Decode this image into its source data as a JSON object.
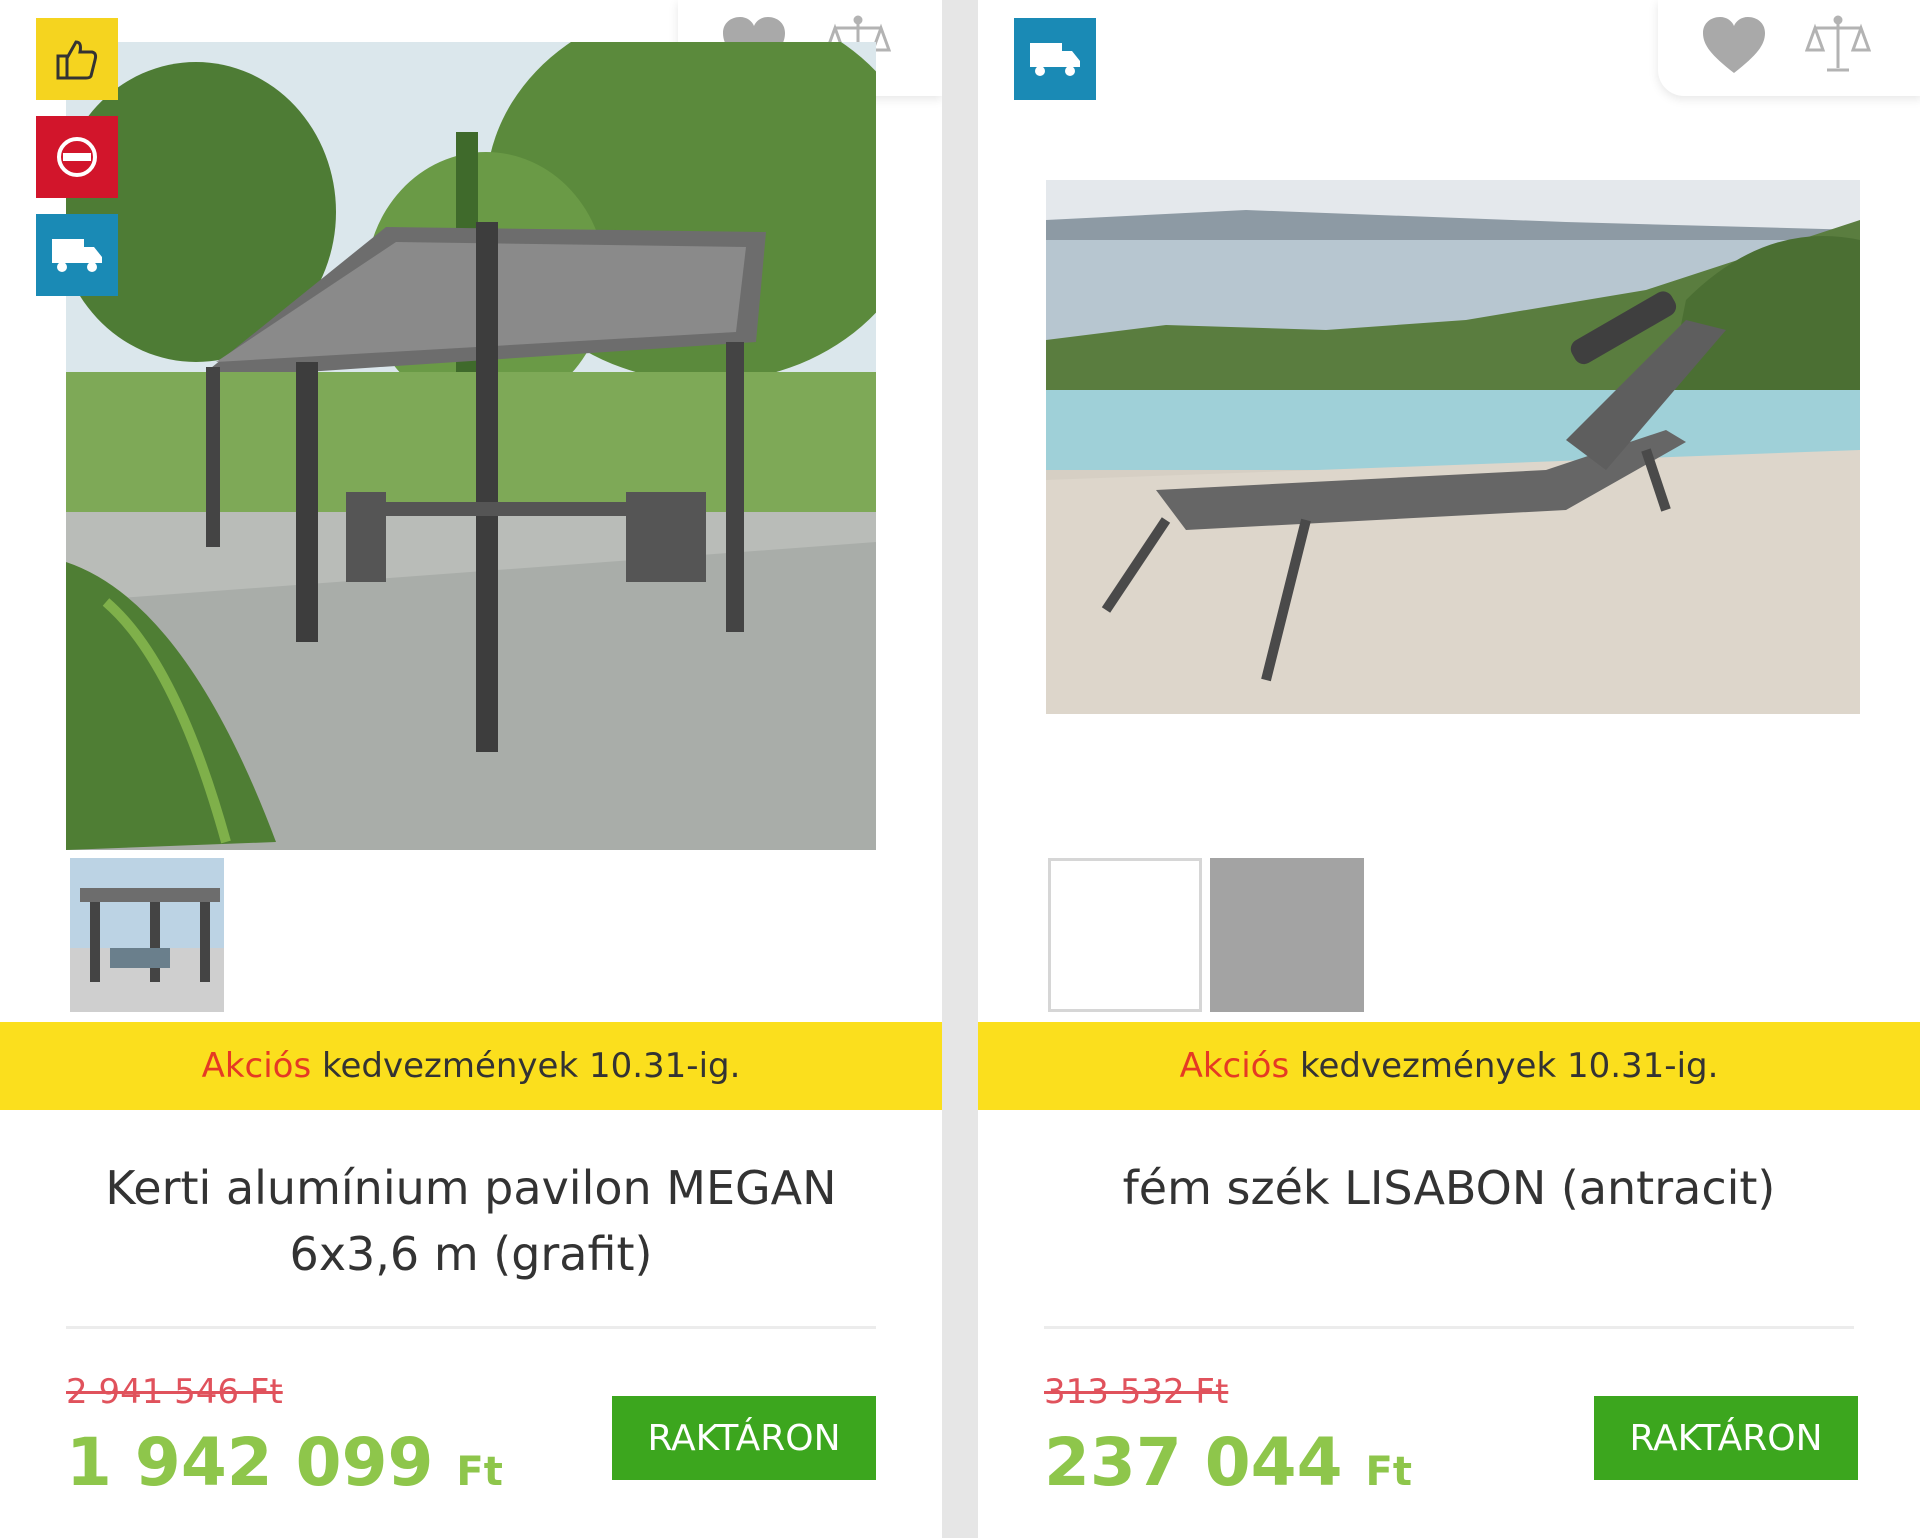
{
  "products": [
    {
      "promo_highlight": "Akciós",
      "promo_rest": "kedvezmények 10.31-ig.",
      "title": "Kerti alumínium pavilon MEGAN 6x3,6 m (grafit)",
      "old_price": "2 941 546 Ft",
      "new_price_value": "1 942 099",
      "currency": "Ft",
      "stock_label": "RAKTÁRON",
      "badges": [
        "thumbs-up-icon",
        "sale-icon",
        "delivery-truck-icon"
      ],
      "image": "garden-pavilion-photo",
      "thumbnails": [
        "pavilion-thumbnail"
      ]
    },
    {
      "promo_highlight": "Akciós",
      "promo_rest": "kedvezmények 10.31-ig.",
      "title": "fém szék LISABON (antracit)",
      "old_price": "313 532 Ft",
      "new_price_value": "237 044",
      "currency": "Ft",
      "stock_label": "RAKTÁRON",
      "badges": [
        "delivery-truck-icon"
      ],
      "image": "sun-lounger-photo",
      "color_swatches": [
        "#ffffff",
        "#a3a3a3"
      ]
    }
  ],
  "colors": {
    "promo_bg": "#fbdf1d",
    "promo_highlight": "#e53a24",
    "old_price": "#e0525c",
    "new_price": "#8ec64b",
    "stock_button": "#3ca61e",
    "badge_like": "#f5d41f",
    "badge_sale": "#d2152b",
    "badge_truck": "#1a8ab5"
  }
}
